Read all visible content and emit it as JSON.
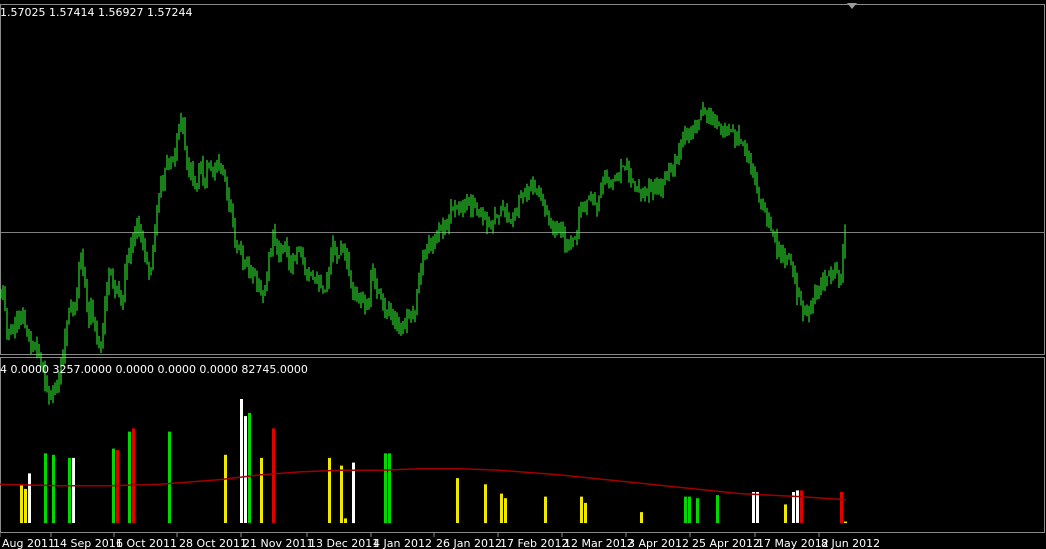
{
  "main_panel": {
    "ohlc_text": "1.57025 1.57414 1.56927 1.57244",
    "candle_color": "#32ff32",
    "background": "#000000",
    "hline_color": "#808080"
  },
  "indicator_panel": {
    "header_text": "4 0.0000 3257.0000 0.0000 0.0000 0.0000 82745.0000",
    "bar_colors": {
      "g": "#00d800",
      "y": "#f0e800",
      "w": "#ffffff",
      "r": "#e00000"
    },
    "ma_color": "#a00000"
  },
  "chart_data": [
    {
      "type": "candlestick",
      "title": "",
      "price_label": "1.57025 1.57414 1.56927 1.57244",
      "x_ticks": [
        "Aug 2011",
        "14 Sep 2011",
        "6 Oct 2011",
        "28 Oct 2011",
        "21 Nov 2011",
        "13 Dec 2011",
        "4 Jan 2012",
        "26 Jan 2012",
        "17 Feb 2012",
        "12 Mar 2012",
        "3 Apr 2012",
        "25 Apr 2012",
        "17 May 2012",
        "8 Jun 2012"
      ],
      "close_path": [
        [
          0,
          292
        ],
        [
          4,
          300
        ],
        [
          8,
          335
        ],
        [
          14,
          330
        ],
        [
          20,
          315
        ],
        [
          26,
          325
        ],
        [
          32,
          347
        ],
        [
          38,
          350
        ],
        [
          44,
          378
        ],
        [
          52,
          400
        ],
        [
          58,
          378
        ],
        [
          64,
          350
        ],
        [
          68,
          312
        ],
        [
          72,
          313
        ],
        [
          76,
          300
        ],
        [
          80,
          255
        ],
        [
          84,
          268
        ],
        [
          88,
          325
        ],
        [
          92,
          308
        ],
        [
          96,
          335
        ],
        [
          100,
          356
        ],
        [
          106,
          300
        ],
        [
          110,
          262
        ],
        [
          114,
          290
        ],
        [
          118,
          288
        ],
        [
          122,
          305
        ],
        [
          126,
          268
        ],
        [
          130,
          250
        ],
        [
          134,
          230
        ],
        [
          138,
          222
        ],
        [
          142,
          245
        ],
        [
          146,
          262
        ],
        [
          150,
          275
        ],
        [
          156,
          220
        ],
        [
          160,
          190
        ],
        [
          166,
          170
        ],
        [
          170,
          160
        ],
        [
          174,
          158
        ],
        [
          180,
          120
        ],
        [
          184,
          132
        ],
        [
          188,
          176
        ],
        [
          192,
          168
        ],
        [
          196,
          198
        ],
        [
          200,
          160
        ],
        [
          204,
          192
        ],
        [
          208,
          158
        ],
        [
          212,
          175
        ],
        [
          216,
          165
        ],
        [
          220,
          160
        ],
        [
          224,
          178
        ],
        [
          228,
          195
        ],
        [
          232,
          215
        ],
        [
          236,
          250
        ],
        [
          240,
          245
        ],
        [
          244,
          262
        ],
        [
          248,
          262
        ],
        [
          252,
          272
        ],
        [
          256,
          278
        ],
        [
          260,
          290
        ],
        [
          264,
          296
        ],
        [
          270,
          250
        ],
        [
          274,
          232
        ],
        [
          278,
          255
        ],
        [
          284,
          245
        ],
        [
          290,
          262
        ],
        [
          296,
          255
        ],
        [
          300,
          248
        ],
        [
          306,
          280
        ],
        [
          310,
          278
        ],
        [
          316,
          285
        ],
        [
          320,
          282
        ],
        [
          324,
          290
        ],
        [
          328,
          275
        ],
        [
          332,
          248
        ],
        [
          336,
          252
        ],
        [
          340,
          255
        ],
        [
          344,
          250
        ],
        [
          348,
          270
        ],
        [
          352,
          290
        ],
        [
          356,
          302
        ],
        [
          360,
          298
        ],
        [
          364,
          300
        ],
        [
          368,
          305
        ],
        [
          372,
          268
        ],
        [
          376,
          290
        ],
        [
          380,
          296
        ],
        [
          386,
          312
        ],
        [
          390,
          308
        ],
        [
          394,
          320
        ],
        [
          398,
          325
        ],
        [
          402,
          335
        ],
        [
          406,
          326
        ],
        [
          410,
          305
        ],
        [
          414,
          318
        ],
        [
          418,
          285
        ],
        [
          422,
          265
        ],
        [
          426,
          252
        ],
        [
          430,
          242
        ],
        [
          434,
          238
        ],
        [
          440,
          228
        ],
        [
          446,
          225
        ],
        [
          450,
          215
        ],
        [
          456,
          202
        ],
        [
          462,
          208
        ],
        [
          466,
          200
        ],
        [
          472,
          206
        ],
        [
          476,
          210
        ],
        [
          480,
          215
        ],
        [
          486,
          220
        ],
        [
          490,
          232
        ],
        [
          496,
          216
        ],
        [
          500,
          212
        ],
        [
          506,
          210
        ],
        [
          510,
          218
        ],
        [
          516,
          215
        ],
        [
          520,
          195
        ],
        [
          526,
          192
        ],
        [
          532,
          188
        ],
        [
          538,
          190
        ],
        [
          544,
          200
        ],
        [
          548,
          220
        ],
        [
          552,
          230
        ],
        [
          558,
          228
        ],
        [
          562,
          234
        ],
        [
          566,
          245
        ],
        [
          570,
          240
        ],
        [
          576,
          238
        ],
        [
          580,
          212
        ],
        [
          584,
          205
        ],
        [
          588,
          200
        ],
        [
          592,
          196
        ],
        [
          598,
          205
        ],
        [
          602,
          185
        ],
        [
          606,
          176
        ],
        [
          612,
          182
        ],
        [
          616,
          176
        ],
        [
          620,
          172
        ],
        [
          624,
          166
        ],
        [
          628,
          172
        ],
        [
          632,
          185
        ],
        [
          636,
          190
        ],
        [
          642,
          196
        ],
        [
          646,
          192
        ],
        [
          650,
          186
        ],
        [
          656,
          190
        ],
        [
          662,
          185
        ],
        [
          666,
          182
        ],
        [
          672,
          170
        ],
        [
          676,
          160
        ],
        [
          680,
          145
        ],
        [
          684,
          130
        ],
        [
          688,
          132
        ],
        [
          692,
          126
        ],
        [
          696,
          122
        ],
        [
          700,
          118
        ],
        [
          704,
          108
        ],
        [
          708,
          112
        ],
        [
          712,
          118
        ],
        [
          716,
          122
        ],
        [
          720,
          124
        ],
        [
          724,
          128
        ],
        [
          728,
          130
        ],
        [
          732,
          132
        ],
        [
          736,
          138
        ],
        [
          740,
          140
        ],
        [
          744,
          148
        ],
        [
          748,
          160
        ],
        [
          752,
          172
        ],
        [
          756,
          190
        ],
        [
          760,
          206
        ],
        [
          764,
          210
        ],
        [
          768,
          218
        ],
        [
          772,
          232
        ],
        [
          776,
          245
        ],
        [
          780,
          250
        ],
        [
          784,
          258
        ],
        [
          788,
          255
        ],
        [
          792,
          262
        ],
        [
          796,
          290
        ],
        [
          800,
          306
        ],
        [
          804,
          310
        ],
        [
          808,
          312
        ],
        [
          812,
          300
        ],
        [
          816,
          292
        ],
        [
          820,
          286
        ],
        [
          824,
          280
        ],
        [
          828,
          270
        ],
        [
          832,
          278
        ],
        [
          836,
          272
        ],
        [
          840,
          282
        ],
        [
          842,
          270
        ],
        [
          844,
          236
        ],
        [
          846,
          230
        ]
      ],
      "horizontal_line": true,
      "grid": false
    },
    {
      "type": "bar",
      "title": "",
      "header": "4 0.0000 3257.0000 0.0000 0.0000 0.0000 82745.0000",
      "max_value": 82745,
      "bars": [
        [
          20,
          25,
          "y"
        ],
        [
          24,
          22,
          "y"
        ],
        [
          28,
          32,
          "w"
        ],
        [
          44,
          45,
          "g"
        ],
        [
          52,
          44,
          "g"
        ],
        [
          68,
          42,
          "g"
        ],
        [
          72,
          42,
          "w"
        ],
        [
          112,
          48,
          "g"
        ],
        [
          116,
          47,
          "r"
        ],
        [
          128,
          59,
          "g"
        ],
        [
          132,
          61,
          "r"
        ],
        [
          168,
          59,
          "g"
        ],
        [
          224,
          44,
          "y"
        ],
        [
          240,
          80,
          "w"
        ],
        [
          244,
          69,
          "w"
        ],
        [
          248,
          71,
          "g"
        ],
        [
          260,
          42,
          "y"
        ],
        [
          272,
          61,
          "r"
        ],
        [
          328,
          42,
          "y"
        ],
        [
          340,
          37,
          "y"
        ],
        [
          344,
          3,
          "y"
        ],
        [
          352,
          39,
          "w"
        ],
        [
          384,
          45,
          "g"
        ],
        [
          388,
          45,
          "g"
        ],
        [
          456,
          29,
          "y"
        ],
        [
          484,
          25,
          "y"
        ],
        [
          500,
          19,
          "y"
        ],
        [
          504,
          16,
          "y"
        ],
        [
          544,
          17,
          "y"
        ],
        [
          580,
          17,
          "y"
        ],
        [
          584,
          13,
          "y"
        ],
        [
          640,
          7,
          "y"
        ],
        [
          684,
          17,
          "g"
        ],
        [
          688,
          17,
          "g"
        ],
        [
          696,
          16,
          "g"
        ],
        [
          716,
          18,
          "g"
        ],
        [
          752,
          20,
          "w"
        ],
        [
          756,
          20,
          "w"
        ],
        [
          784,
          12,
          "y"
        ],
        [
          792,
          20,
          "w"
        ],
        [
          796,
          21,
          "w"
        ],
        [
          800,
          21,
          "r"
        ],
        [
          840,
          20,
          "r"
        ],
        [
          844,
          1,
          "y"
        ]
      ],
      "ma_line": [
        [
          0,
          25
        ],
        [
          60,
          24
        ],
        [
          110,
          24
        ],
        [
          160,
          25
        ],
        [
          220,
          28
        ],
        [
          260,
          31
        ],
        [
          300,
          33
        ],
        [
          340,
          34
        ],
        [
          380,
          34
        ],
        [
          420,
          35
        ],
        [
          460,
          35
        ],
        [
          500,
          34
        ],
        [
          560,
          31
        ],
        [
          620,
          27
        ],
        [
          680,
          23
        ],
        [
          740,
          19
        ],
        [
          800,
          17
        ],
        [
          846,
          15
        ]
      ]
    }
  ]
}
